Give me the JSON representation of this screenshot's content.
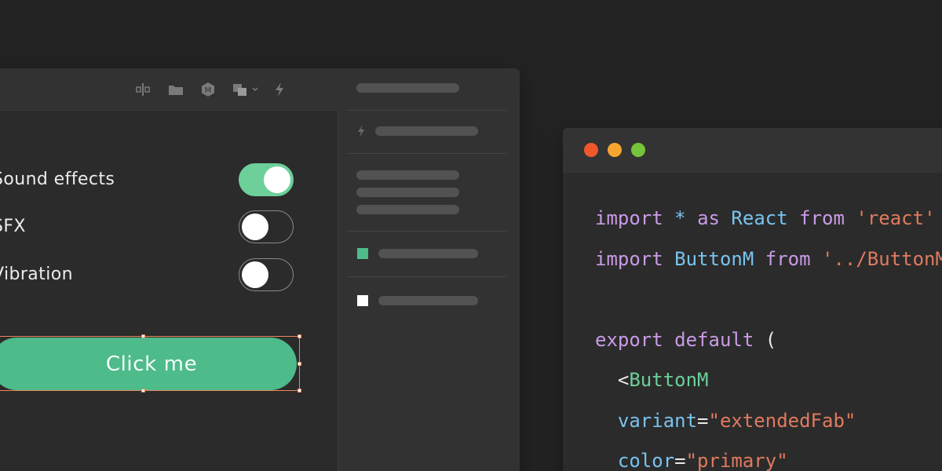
{
  "settings": {
    "items": [
      {
        "label": "Sound effects",
        "enabled": true
      },
      {
        "label": "SFX",
        "enabled": false
      },
      {
        "label": "Vibration",
        "enabled": false
      }
    ],
    "button_label": "Click me"
  },
  "toolbar": {
    "icons": [
      "distribute-icon",
      "folder-icon",
      "component-icon",
      "layers-dropdown-icon",
      "lightning-icon"
    ]
  },
  "code": {
    "lines": [
      [
        {
          "t": "import ",
          "c": "kw"
        },
        {
          "t": "* ",
          "c": "ident"
        },
        {
          "t": "as ",
          "c": "kw"
        },
        {
          "t": "React ",
          "c": "ident"
        },
        {
          "t": "from ",
          "c": "kw"
        },
        {
          "t": "'react'",
          "c": "str"
        }
      ],
      [
        {
          "t": "import ",
          "c": "kw"
        },
        {
          "t": "ButtonM ",
          "c": "ident"
        },
        {
          "t": "from ",
          "c": "kw"
        },
        {
          "t": "'../ButtonM'",
          "c": "str"
        }
      ],
      [],
      [
        {
          "t": "export ",
          "c": "kw"
        },
        {
          "t": "default ",
          "c": "kw"
        },
        {
          "t": "(",
          "c": "plain"
        }
      ],
      [
        {
          "t": "  <",
          "c": "plain"
        },
        {
          "t": "ButtonM",
          "c": "tag"
        }
      ],
      [
        {
          "t": "  variant",
          "c": "attr"
        },
        {
          "t": "=",
          "c": "plain"
        },
        {
          "t": "\"extendedFab\"",
          "c": "str"
        }
      ],
      [
        {
          "t": "  color",
          "c": "attr"
        },
        {
          "t": "=",
          "c": "plain"
        },
        {
          "t": "\"primary\"",
          "c": "str"
        }
      ]
    ]
  },
  "colors": {
    "accent_green": "#4dbb8a",
    "toggle_on": "#6dcf9a",
    "selection": "#e8865a",
    "traffic_red": "#f0572a",
    "traffic_yellow": "#f6a630",
    "traffic_green": "#76c43a"
  }
}
